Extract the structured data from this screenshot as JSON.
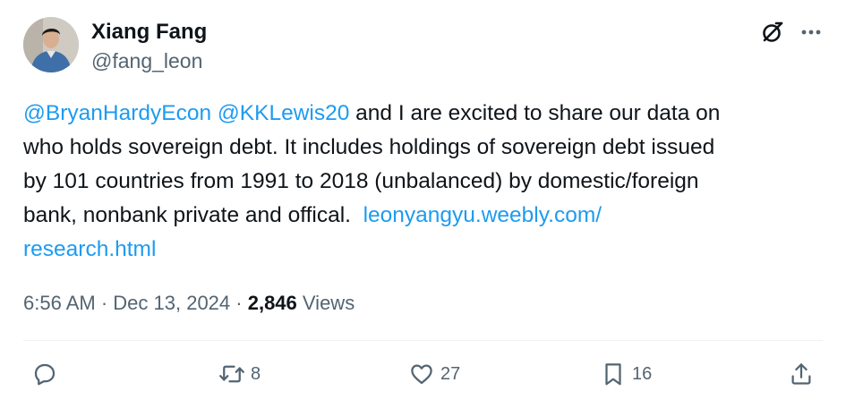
{
  "author": {
    "display_name": "Xiang Fang",
    "handle": "@fang_leon"
  },
  "header_icons": [
    "grok-icon",
    "more-icon"
  ],
  "tweet": {
    "lines": [
      {
        "segments": [
          {
            "text": "@BryanHardyEcon",
            "link": true
          },
          {
            "text": " ",
            "link": false
          },
          {
            "text": "@KKLewis20",
            "link": true
          },
          {
            "text": " and I are excited to share our data on",
            "link": false
          }
        ]
      },
      {
        "segments": [
          {
            "text": "who holds sovereign debt. It includes holdings of sovereign debt issued",
            "link": false
          }
        ]
      },
      {
        "segments": [
          {
            "text": "by 101 countries from 1991 to 2018 (unbalanced) by domestic/foreign",
            "link": false
          }
        ]
      },
      {
        "segments": [
          {
            "text": "bank, nonbank private and offical.  ",
            "link": false
          },
          {
            "text": "leonyangyu.weebly.com/",
            "link": true
          }
        ]
      },
      {
        "segments": [
          {
            "text": "research.html",
            "link": true
          }
        ]
      }
    ]
  },
  "meta": {
    "time": "6:56 AM",
    "separator": " · ",
    "date": "Dec 13, 2024",
    "views_count": "2,846",
    "views_label": "Views"
  },
  "actions": {
    "reply": {
      "icon": "reply-icon",
      "count": ""
    },
    "repost": {
      "icon": "repost-icon",
      "count": "8"
    },
    "like": {
      "icon": "heart-icon",
      "count": "27"
    },
    "bookmark": {
      "icon": "bookmark-icon",
      "count": "16"
    },
    "share": {
      "icon": "share-icon",
      "count": ""
    }
  },
  "colors": {
    "link": "#1d9bf0",
    "secondary_text": "#536471",
    "primary_text": "#0f1419",
    "divider": "#eff3f4"
  }
}
